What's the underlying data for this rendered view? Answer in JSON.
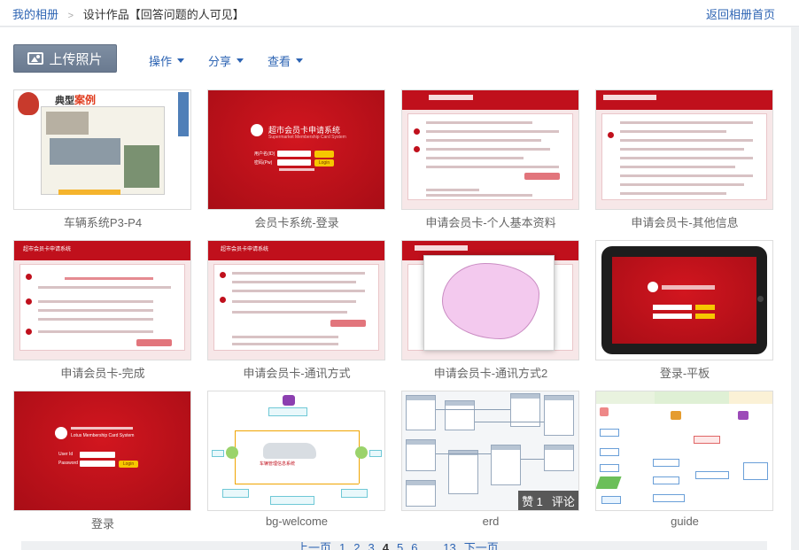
{
  "breadcrumb": {
    "home": "我的相册",
    "separator": ">",
    "album": "设计作品【回答问题的人可见】"
  },
  "header": {
    "back_label": "返回相册首页"
  },
  "toolbar": {
    "upload_label": "上传照片",
    "menus": [
      "操作",
      "分享",
      "查看"
    ]
  },
  "photos": [
    {
      "caption": "车辆系统P3-P4"
    },
    {
      "caption": "会员卡系统-登录"
    },
    {
      "caption": "申请会员卡-个人基本资料"
    },
    {
      "caption": "申请会员卡-其他信息"
    },
    {
      "caption": "申请会员卡-完成"
    },
    {
      "caption": "申请会员卡-通讯方式"
    },
    {
      "caption": "申请会员卡-通讯方式2"
    },
    {
      "caption": "登录-平板"
    },
    {
      "caption": "登录"
    },
    {
      "caption": "bg-welcome"
    },
    {
      "caption": "erd",
      "overlay": {
        "like": "赞 1",
        "comment": "评论"
      }
    },
    {
      "caption": "guide"
    }
  ],
  "thumb_text": {
    "car_title": "典型",
    "car_title_accent": "案例",
    "login_title": "超市会员卡申请系统",
    "login_subtitle": "Supermarket Membership Card System",
    "login_user": "用户名(ID)",
    "login_pass": "密码(Pw)",
    "login_btn": "Login",
    "apply_title": "超市会员卡申请系统",
    "lotus_title": "Lotus Membership Card System",
    "lotus_user": "User Id",
    "lotus_pass": "Password",
    "lotus_btn": "Login",
    "welcome_label": "车辆管理信息系统"
  },
  "pager": {
    "prev": "上一页",
    "pages": [
      "1",
      "2",
      "3",
      "4",
      "5",
      "6",
      "...",
      "13"
    ],
    "current": "4",
    "next": "下一页"
  },
  "colors": {
    "link": "#2d64b3",
    "brand_red": "#c0101c",
    "button": "#6a7a90"
  }
}
